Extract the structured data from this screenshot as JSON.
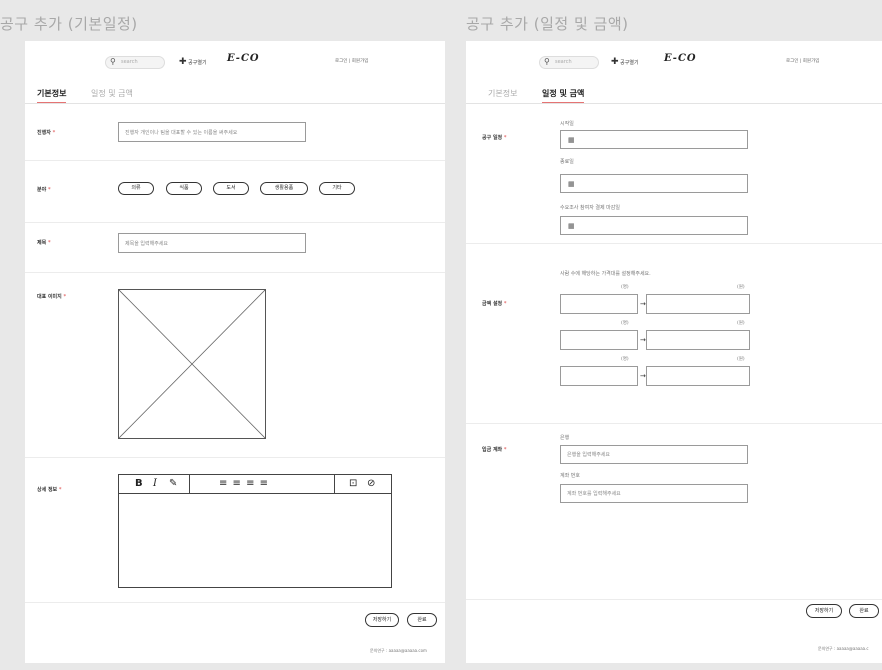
{
  "frames": {
    "basic_title": "공구 추가 (기본일정)",
    "schedule_title": "공구 추가 (일정 및 금액)"
  },
  "topbar": {
    "search_placeholder": "search",
    "create_label": "공구열기",
    "logo": "E-CO",
    "links": "로그인 | 회원가입"
  },
  "tabs": {
    "basic": "기본정보",
    "schedule": "일정 및 금액"
  },
  "basic": {
    "host_label": "진행자",
    "host_placeholder": "진행자 개인이나 팀을 대표할 수 있는 이름을 써주세요",
    "category_label": "분야",
    "categories": [
      "의류",
      "식품",
      "도서",
      "생활용품",
      "기타"
    ],
    "title_label": "제목",
    "title_placeholder": "제목을 입력해주세요",
    "image_label": "대표 이미지",
    "detail_label": "상세 정보",
    "editor_tools": {
      "bold": "B",
      "italic": "I",
      "pen": "✎",
      "align": "≡ ≡ ≡ ≡",
      "image": "⊡",
      "link": "⊘"
    },
    "save_label": "저장하기",
    "done_label": "완료",
    "footer": "문의연구 : aaaaa@aaaaa.com"
  },
  "schedule": {
    "period_label": "공구 일정",
    "start_label": "시작일",
    "end_label": "종료일",
    "demand_label": "수요조사 참여자 결제 마감일",
    "price_label": "금액 설정",
    "price_hint": "사람 수에 해당하는 가격대를 설정해주세요.",
    "unit_people": "(명)",
    "unit_won": "(원)",
    "account_label": "입금 계좌",
    "bank_label": "은행",
    "bank_placeholder": "은행을 입력해주세요",
    "acct_label": "계좌 번호",
    "acct_placeholder": "계좌 번호를 입력해주세요",
    "save_label": "저장하기",
    "done_label": "완료",
    "footer": "문의연구 : aaaaa@aaaaa.c"
  },
  "required_mark": "*"
}
